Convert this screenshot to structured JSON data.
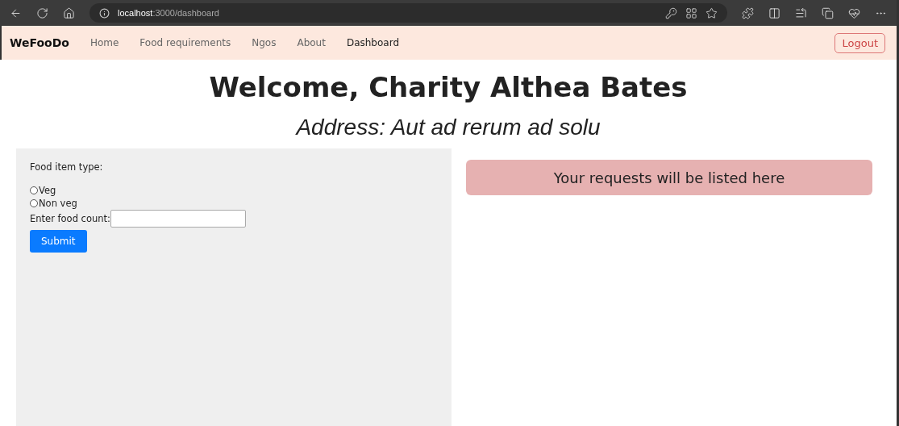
{
  "browser": {
    "url_host": "localhost",
    "url_path": ":3000/dashboard"
  },
  "navbar": {
    "brand": "WeFooDo",
    "links": [
      {
        "label": "Home",
        "selected": false
      },
      {
        "label": "Food requirements",
        "selected": false
      },
      {
        "label": "Ngos",
        "selected": false
      },
      {
        "label": "About",
        "selected": false
      },
      {
        "label": "Dashboard",
        "selected": true
      }
    ],
    "logout": "Logout"
  },
  "heading": "Welcome, Charity Althea Bates",
  "address": "Address: Aut ad rerum ad solu",
  "form": {
    "label": "Food item type:",
    "options": [
      {
        "label": "Veg",
        "selected": false
      },
      {
        "label": "Non veg",
        "selected": false
      }
    ],
    "count_label": "Enter food count:",
    "submit": "Submit"
  },
  "requests": {
    "title": "Your requests will be listed here"
  }
}
